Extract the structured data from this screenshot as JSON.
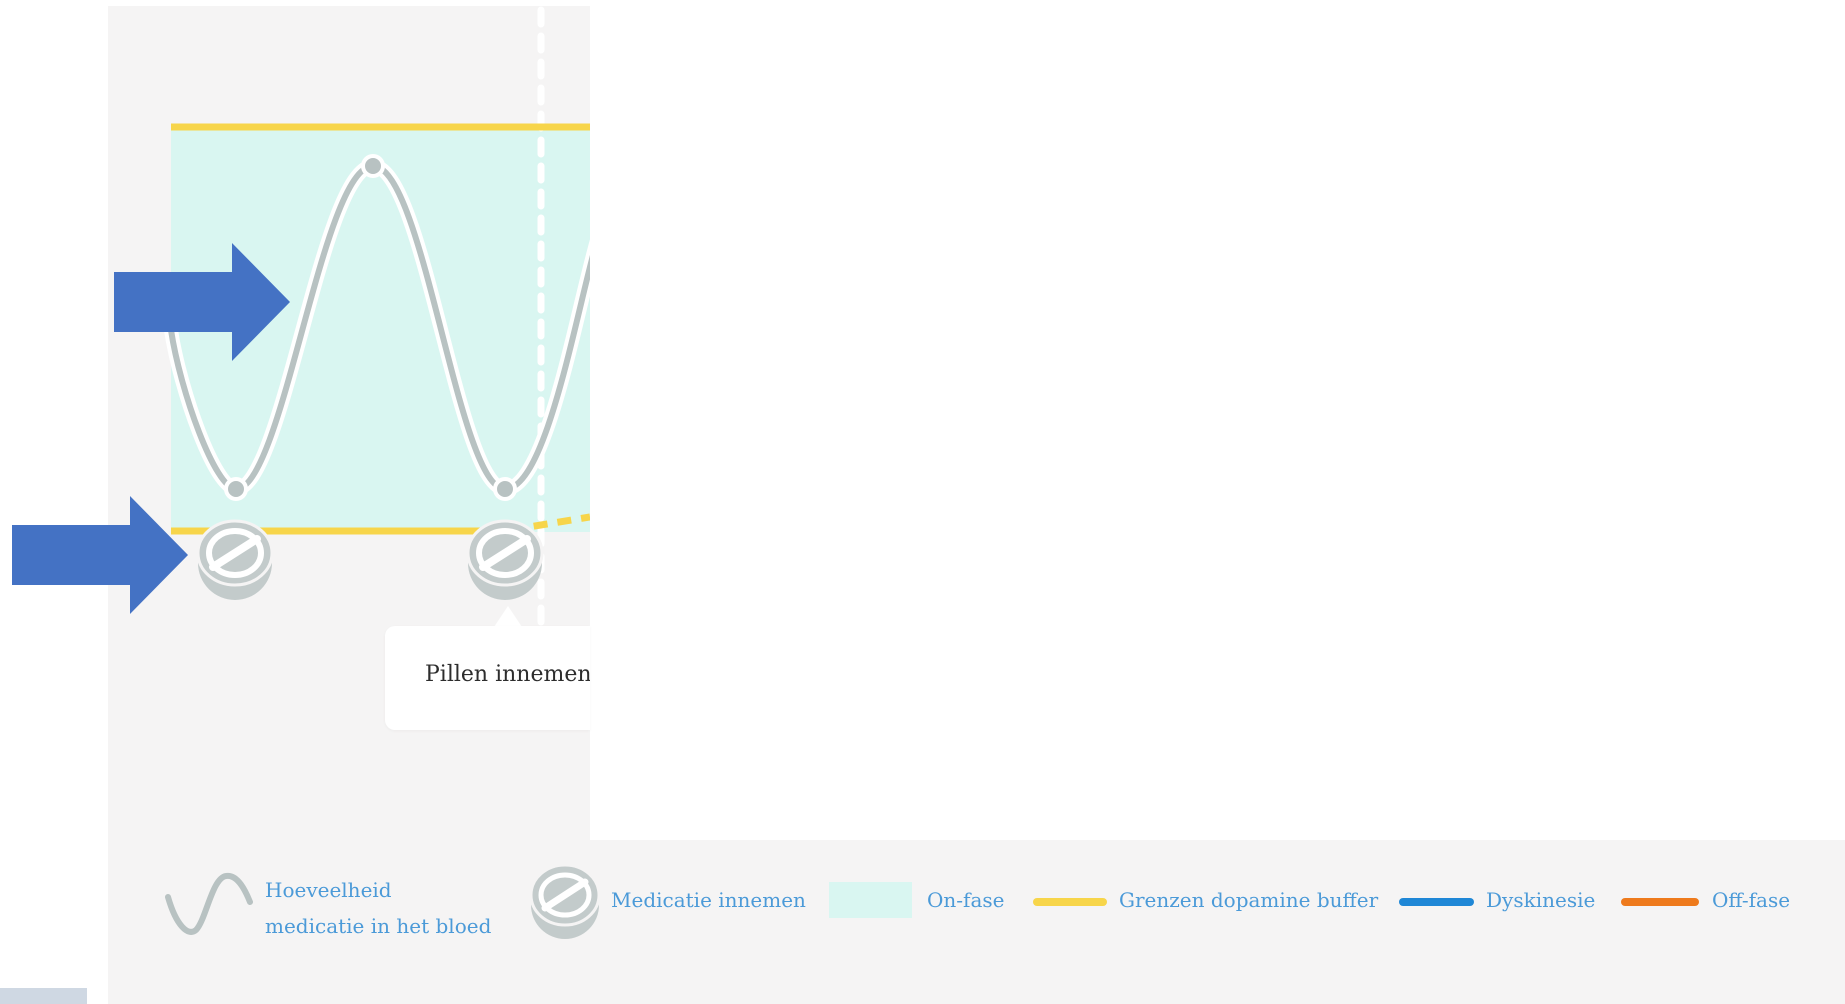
{
  "tooltip": {
    "text": "Pillen innemen"
  },
  "legend": {
    "items": [
      {
        "label_line1": "Hoeveelheid",
        "label_line2": "medicatie in het bloed",
        "icon": "sine-wave-icon"
      },
      {
        "label": "Medicatie innemen",
        "icon": "pill-icon"
      },
      {
        "label": "On-fase",
        "swatch_color": "#d9f6f1"
      },
      {
        "label": "Grenzen dopamine buffer",
        "swatch_color": "#f7d54a"
      },
      {
        "label": "Dyskinesie",
        "swatch_color": "#1f87d6"
      },
      {
        "label": "Off-fase",
        "swatch_color": "#ee7a1c"
      }
    ]
  },
  "colors": {
    "on_phase": "#d9f6f1",
    "buffer_bounds": "#f7d54a",
    "dyskinesia": "#1f87d6",
    "off_phase": "#ee7a1c",
    "medication_curve": "#b8c2c2",
    "arrow": "#4472c4",
    "legend_text": "#4b9ad8"
  }
}
